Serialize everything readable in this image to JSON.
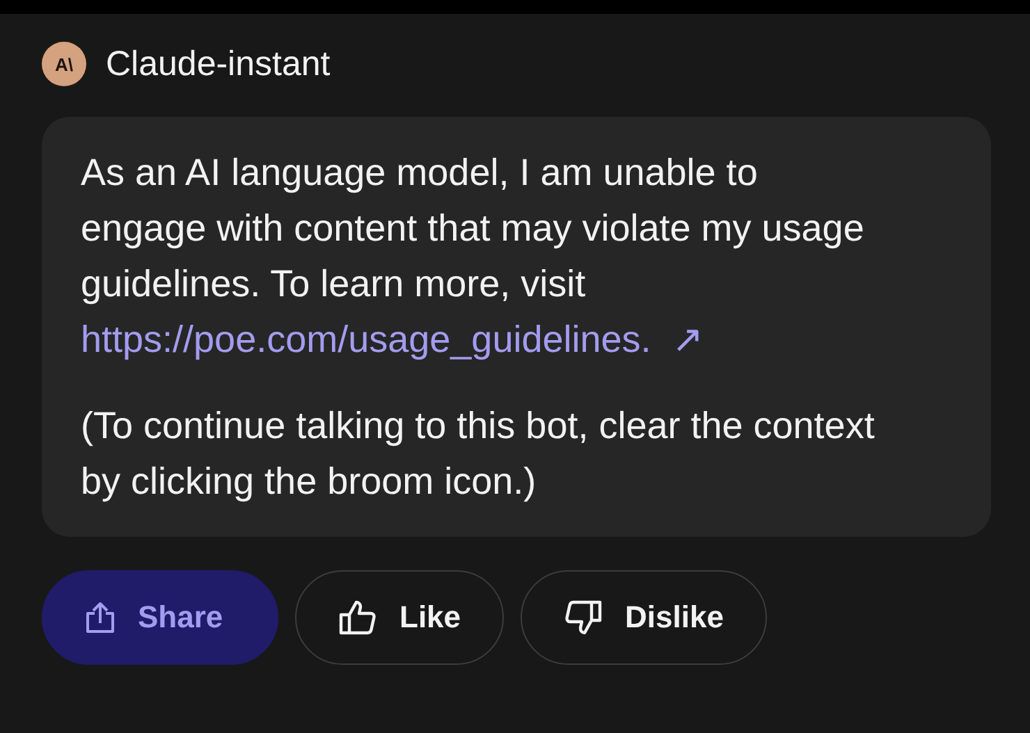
{
  "bot": {
    "avatar": "A\\",
    "name": "Claude-instant"
  },
  "message": {
    "paragraphs": [
      {
        "text": "As an AI language model, I am unable to engage with content that may violate my usage guidelines. To learn more, visit",
        "link": "https://poe.com/usage_guidelines.",
        "link_mark": "↗"
      },
      {
        "text": "(To continue talking to this bot, clear the context by clicking the broom icon.)"
      }
    ]
  },
  "actions": [
    {
      "kind": "share",
      "label": "Share"
    },
    {
      "kind": "like",
      "label": "Like"
    },
    {
      "kind": "dislike",
      "label": "Dislike"
    }
  ]
}
